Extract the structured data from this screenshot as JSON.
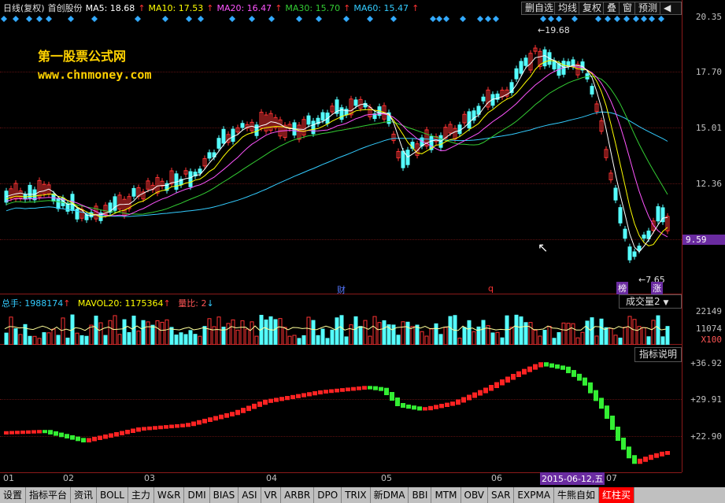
{
  "header": {
    "title": "日线(复权)",
    "stock": "首创股份",
    "ma": [
      {
        "label": "MA5: 18.68",
        "color": "#ffffff"
      },
      {
        "label": "MA10: 17.53",
        "color": "#ffff00"
      },
      {
        "label": "MA20: 16.47",
        "color": "#ff55ff"
      },
      {
        "label": "MA30: 15.70",
        "color": "#33cc33"
      },
      {
        "label": "MA60: 15.47",
        "color": "#33ccff"
      }
    ],
    "buttons": [
      "删自选",
      "均线",
      "复权",
      "叠",
      "窗",
      "预测"
    ]
  },
  "logo": {
    "line1": "第一股票公式网",
    "line2": "www.chnmoney.com"
  },
  "price_axis": [
    "20.35",
    "17.70",
    "15.01",
    "12.36",
    "9.59"
  ],
  "price_labels": {
    "high": "19.68",
    "low": "7.65",
    "current": "9.59"
  },
  "markers": {
    "cai": "财",
    "q": "q",
    "bang": "榜",
    "zhang": "涨"
  },
  "volume": {
    "total_label": "总手: 1988174",
    "mavol_label": "MAVOL20: 1175364",
    "ratio_label": "量比: 2",
    "indicator": "成交量2",
    "axis": [
      "22149",
      "11074",
      "X100"
    ]
  },
  "indicator_help": "指标说明",
  "macd_axis": [
    "+36.92",
    "+29.91",
    "+22.90"
  ],
  "months": [
    "01",
    "02",
    "03",
    "04",
    "05",
    "06",
    "07"
  ],
  "date_label": "2015-06-12,五",
  "tabs": [
    "设置",
    "指标平台",
    "资讯",
    "BOLL",
    "主力",
    "W&R",
    "DMI",
    "BIAS",
    "ASI",
    "VR",
    "ARBR",
    "DPO",
    "TRIX",
    "新DMA",
    "BBI",
    "MTM",
    "OBV",
    "SAR",
    "EXPMA",
    "牛熊自如",
    "红柱买"
  ],
  "colors": {
    "up": "#ff3333",
    "down": "#55ffff",
    "grid": "#8b1a1a",
    "highlight": "#6a2ba0"
  }
}
